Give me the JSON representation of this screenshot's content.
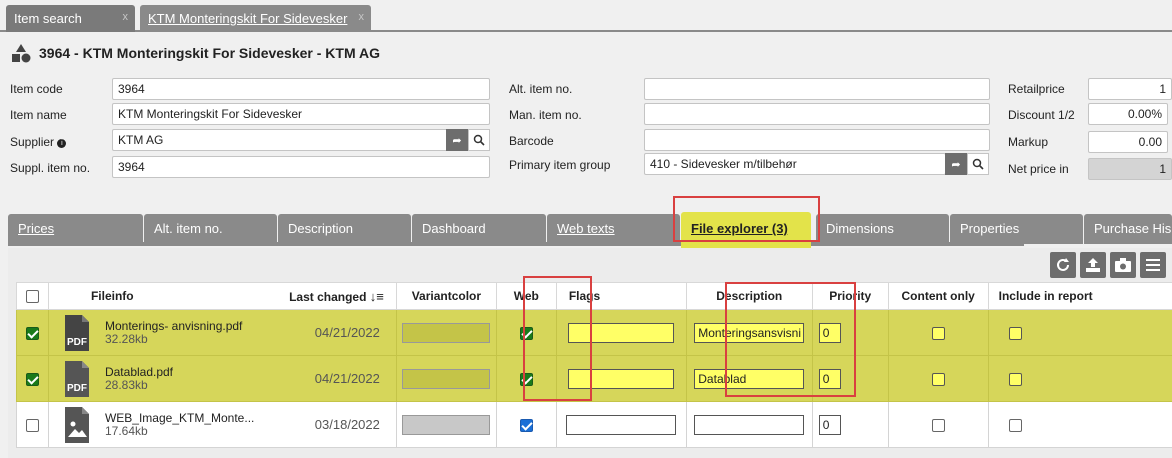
{
  "top_tabs": [
    {
      "label": "Item search"
    },
    {
      "label": "KTM Monteringskit For Sidevesker"
    }
  ],
  "title": "3964 - KTM Monteringskit For Sidevesker - KTM AG",
  "form": {
    "item_code_label": "Item code",
    "item_code": "3964",
    "item_name_label": "Item name",
    "item_name": "KTM Monteringskit For Sidevesker",
    "supplier_label": "Supplier",
    "supplier": "KTM AG",
    "suppl_item_no_label": "Suppl. item no.",
    "suppl_item_no": "3964",
    "alt_item_no_label": "Alt. item no.",
    "alt_item_no": "",
    "man_item_no_label": "Man. item no.",
    "man_item_no": "",
    "barcode_label": "Barcode",
    "barcode": "",
    "primary_item_group_label": "Primary item group",
    "primary_item_group": "410 - Sidevesker m/tilbehør",
    "retailprice_label": "Retailprice",
    "retailprice": "1",
    "discount_label": "Discount 1/2",
    "discount": "0.00%",
    "markup_label": "Markup",
    "markup": "0.00",
    "net_price_label": "Net price in",
    "net_price": "1"
  },
  "section_tabs": [
    {
      "label": "Prices"
    },
    {
      "label": "Alt. item no."
    },
    {
      "label": "Description"
    },
    {
      "label": "Dashboard"
    },
    {
      "label": "Web texts"
    },
    {
      "label": "File explorer (3)"
    },
    {
      "label": "Dimensions"
    },
    {
      "label": "Properties"
    },
    {
      "label": "Purchase His"
    }
  ],
  "table": {
    "headers": {
      "fileinfo": "Fileinfo",
      "last_changed": "Last changed",
      "variantcolor": "Variantcolor",
      "web": "Web",
      "flags": "Flags",
      "description": "Description",
      "priority": "Priority",
      "content_only": "Content only",
      "include_in_report": "Include in report"
    },
    "rows": [
      {
        "name": "Monterings- anvisning.pdf",
        "size": "32.28kb",
        "date": "04/21/2022",
        "description": "Monteringsansvisni",
        "priority": "0"
      },
      {
        "name": "Datablad.pdf",
        "size": "28.83kb",
        "date": "04/21/2022",
        "description": "Datablad",
        "priority": "0"
      },
      {
        "name": "WEB_Image_KTM_Monte...",
        "size": "17.64kb",
        "date": "03/18/2022",
        "description": "",
        "priority": "0"
      }
    ]
  },
  "icons": [
    "close-icon",
    "item-shapes-icon",
    "info-icon",
    "link-arrow-icon",
    "search-icon",
    "pdf-file-icon",
    "image-file-icon",
    "refresh-icon",
    "upload-icon",
    "camera-icon",
    "menu-icon",
    "sort-icon"
  ],
  "colors": {
    "selected_row": "#d6d65a",
    "active_tab": "#e3e34a",
    "checked_box": "#1a7a1a",
    "highlight_box": "#d94040"
  }
}
